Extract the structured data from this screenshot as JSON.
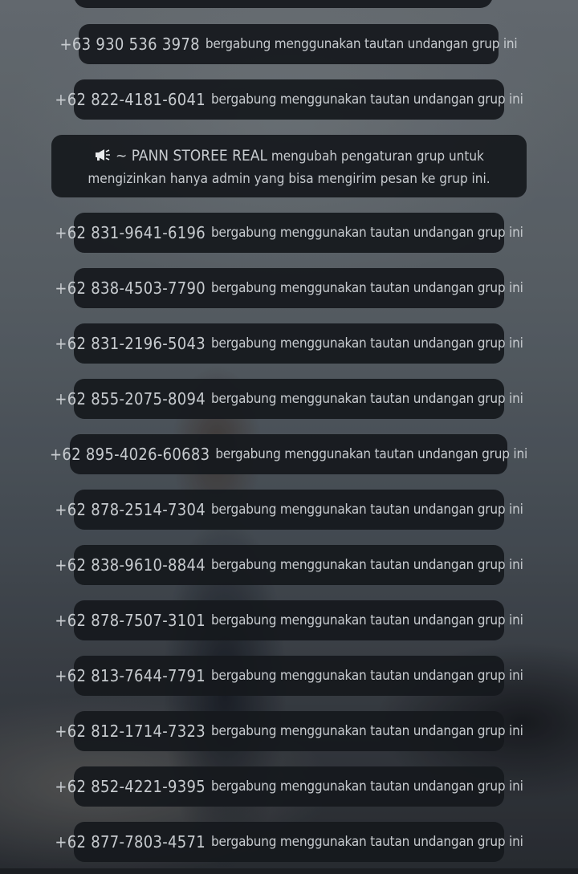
{
  "notice": {
    "icon": "megaphone-icon",
    "sender": "~ PANN STOREE REAL",
    "text": "mengubah pengaturan grup untuk mengizinkan hanya admin yang bisa mengirim pesan ke grup ini."
  },
  "join_text": "bergabung menggunakan tautan undangan grup ini",
  "messages": [
    {
      "number": "+63 930 536 3978"
    },
    {
      "number": "+62 822-4181-6041"
    },
    {
      "number": "+62 831-9641-6196"
    },
    {
      "number": "+62 838-4503-7790"
    },
    {
      "number": "+62 831-2196-5043"
    },
    {
      "number": "+62 855-2075-8094"
    },
    {
      "number": "+62 895-4026-60683"
    },
    {
      "number": "+62 878-2514-7304"
    },
    {
      "number": "+62 838-9610-8844"
    },
    {
      "number": "+62 878-7507-3101"
    },
    {
      "number": "+62 813-7644-7791"
    },
    {
      "number": "+62 812-1714-7323"
    },
    {
      "number": "+62 852-4221-9395"
    },
    {
      "number": "+62 877-7803-4571"
    }
  ]
}
